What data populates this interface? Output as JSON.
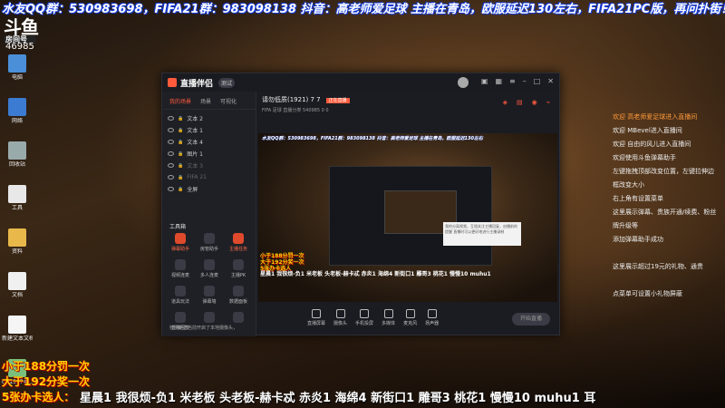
{
  "banner": {
    "text": "水友QQ群：530983698，FIFA21群：983098138 抖音：高老师爱足球 主播在青岛，欧服延迟130左右，FIFA21PC版，再问扑街！"
  },
  "logo": {
    "text": "斗鱼",
    "sub": "房间号"
  },
  "room_id": "46985",
  "desktop_icons": [
    {
      "name": "computer-icon",
      "label": "电脑"
    },
    {
      "name": "network-icon",
      "label": "网络"
    },
    {
      "name": "recycle-bin-icon",
      "label": "回收站"
    },
    {
      "name": "file-icon",
      "label": "工具"
    },
    {
      "name": "folder-icon",
      "label": "资料"
    },
    {
      "name": "doc-icon",
      "label": "文档"
    },
    {
      "name": "text-file-icon",
      "label": "新建文本文档"
    },
    {
      "name": "image-icon",
      "label": "cw156745..."
    }
  ],
  "window": {
    "app_name": "直播伴侣",
    "version": "测试",
    "tabs": [
      {
        "label": "我的场景",
        "active": true
      },
      {
        "label": "场景"
      },
      {
        "label": "可视化"
      }
    ],
    "scenes": [
      {
        "label": "文本 2",
        "dim": false
      },
      {
        "label": "文本 1",
        "dim": false
      },
      {
        "label": "文本 4",
        "dim": false
      },
      {
        "label": "图片 1",
        "dim": false
      },
      {
        "label": "文本 3",
        "dim": true
      },
      {
        "label": "FIFA 21",
        "dim": true
      },
      {
        "label": "全屏",
        "dim": false
      }
    ],
    "tools_title": "工具箱",
    "tools": [
      {
        "label": "弹幕助手",
        "hot": true
      },
      {
        "label": "房管助手",
        "hot": false
      },
      {
        "label": "主播任务",
        "hot": true
      },
      {
        "label": "视频连麦",
        "hot": false
      },
      {
        "label": "多人连麦",
        "hot": false
      },
      {
        "label": "主播PK",
        "hot": false
      },
      {
        "label": "道具玩法",
        "hot": false
      },
      {
        "label": "弹幕墙",
        "hot": false
      },
      {
        "label": "数据面板",
        "hot": false
      },
      {
        "label": "直播回放",
        "hot": false
      },
      {
        "label": "",
        "hot": false
      },
      {
        "label": "",
        "hot": false
      }
    ],
    "bottom_hint": "检测到您当前开启了本地摄像头，",
    "room_title": "请勿低质(1921)  7  7",
    "tag": "正在直播",
    "info_row": "FIFA 足球  直播分类 540985  0  0",
    "preview": {
      "banner": "水友QQ群：530983698，FIFA21群：983098138 抖音：高老师爱足球 主播在青岛，欧服延迟130左右",
      "rules": [
        "小于188分罚一次",
        "大于192分奖一次",
        "5张办卡选人"
      ],
      "ticker": "星晨1 我很烦-负1 米老板 头老板-赫卡忒 赤炎1 海绵4 新街口1 雕哥3 桃花1 慢慢10 muhu1",
      "tooltip": "我的分离视频，互相关注主播回复，启播前的提醒 直播时可以更好地进行主播录制"
    },
    "controls": [
      {
        "label": "直播屏幕",
        "icon": "screen-icon"
      },
      {
        "label": "摄像头",
        "icon": "camera-icon"
      },
      {
        "label": "手机投屏",
        "icon": "phone-icon"
      },
      {
        "label": "多媒体",
        "icon": "media-icon"
      },
      {
        "label": "麦克风",
        "icon": "mic-icon"
      },
      {
        "label": "扬声器",
        "icon": "speaker-icon"
      }
    ],
    "go_live": "开始直播"
  },
  "chat": [
    {
      "text": "欢迎 高老师爱足球进入直播间",
      "hl": true
    },
    {
      "text": "欢迎 MBevel进入直播间",
      "hl": false
    },
    {
      "text": "欢迎 自由的风儿进入直播间",
      "hl": false
    },
    {
      "text": "欢迎使用斗鱼弹幕助手",
      "hl": false
    },
    {
      "text": "左键拖拽顶部改变位置，左键拉伸边",
      "hl": false
    },
    {
      "text": "框改变大小",
      "hl": false
    },
    {
      "text": "右上角有设置菜单",
      "hl": false
    },
    {
      "text": "这里展示弹幕、贵族开通/续费、粉丝",
      "hl": false
    },
    {
      "text": "牌升级等",
      "hl": false
    },
    {
      "text": "添加弹幕助手成功",
      "hl": false
    },
    {
      "text": "",
      "hl": false
    },
    {
      "text": "这里展示超过19元的礼物、通贵",
      "hl": false
    },
    {
      "text": "",
      "hl": false
    },
    {
      "text": "点菜单可设置小礼物屏蔽",
      "hl": false
    }
  ],
  "rules": [
    "小于188分罚一次",
    "大于192分奖一次",
    "5张办卡选人："
  ],
  "ticker": "星晨1 我很烦-负1 米老板 头老板-赫卡忒 赤炎1 海绵4 新街口1 雕哥3 桃花1 慢慢10 muhu1 耳"
}
